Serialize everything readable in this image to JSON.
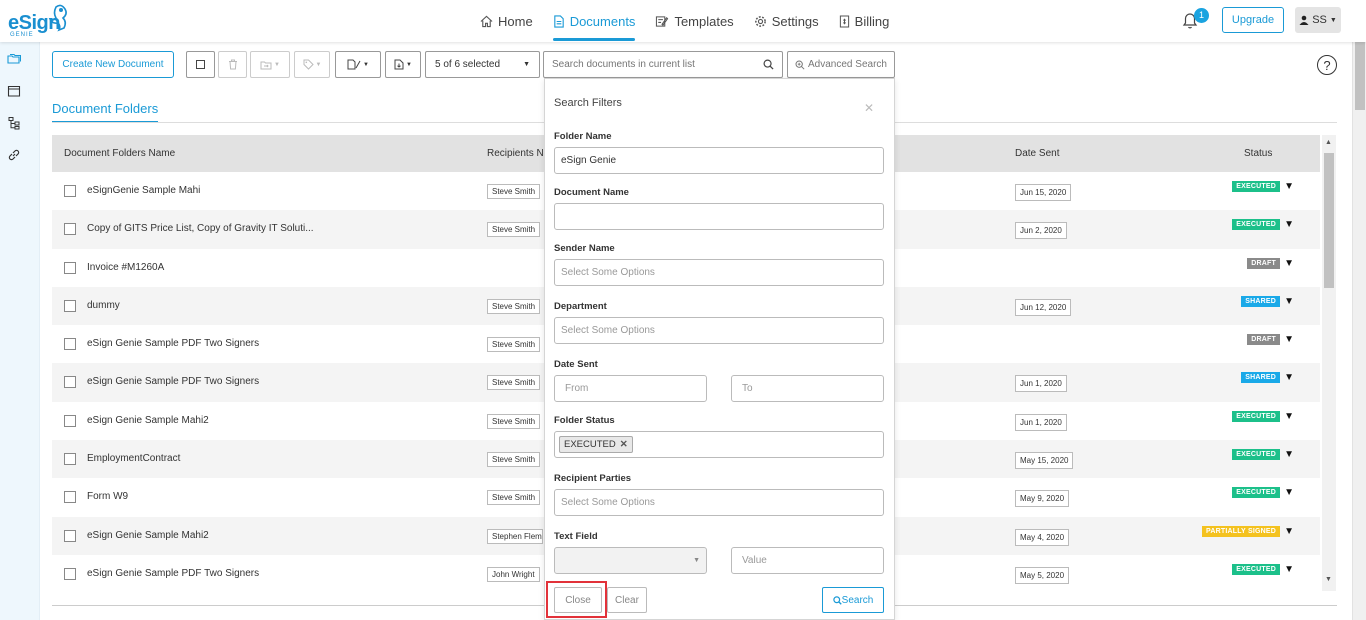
{
  "brand": {
    "logo_text": "eSign",
    "logo_sub": "GENIE"
  },
  "nav": [
    {
      "label": "Home",
      "icon": "home-icon"
    },
    {
      "label": "Documents",
      "icon": "document-icon",
      "active": true
    },
    {
      "label": "Templates",
      "icon": "template-icon"
    },
    {
      "label": "Settings",
      "icon": "gear-icon"
    },
    {
      "label": "Billing",
      "icon": "billing-icon"
    }
  ],
  "header": {
    "notification_count": "1",
    "upgrade_label": "Upgrade",
    "user_initials": "SS"
  },
  "toolbar": {
    "create_label": "Create New Document",
    "selection": "5 of 6 selected",
    "search_placeholder": "Search documents in current list",
    "advanced_label": "Advanced Search"
  },
  "section": {
    "title": "Document Folders"
  },
  "table": {
    "headers": {
      "name": "Document Folders Name",
      "recipients": "Recipients Na",
      "date": "Date Sent",
      "status": "Status"
    },
    "rows": [
      {
        "name": "eSignGenie Sample Mahi",
        "recipient": "Steve Smith",
        "date": "Jun 15, 2020",
        "status": "EXECUTED"
      },
      {
        "name": "Copy of GITS Price List, Copy of Gravity IT Soluti...",
        "recipient": "Steve Smith",
        "date": "Jun 2, 2020",
        "status": "EXECUTED"
      },
      {
        "name": "Invoice #M1260A",
        "recipient": "",
        "date": "",
        "status": "DRAFT"
      },
      {
        "name": "dummy",
        "recipient": "Steve Smith",
        "date": "Jun 12, 2020",
        "status": "SHARED"
      },
      {
        "name": "eSign Genie Sample PDF Two Signers",
        "recipient": "Steve Smith",
        "date": "",
        "status": "DRAFT"
      },
      {
        "name": "eSign Genie Sample PDF Two Signers",
        "recipient": "Steve Smith",
        "date": "Jun 1, 2020",
        "status": "SHARED"
      },
      {
        "name": "eSign Genie Sample Mahi2",
        "recipient": "Steve Smith",
        "date": "Jun 1, 2020",
        "status": "EXECUTED"
      },
      {
        "name": "EmploymentContract",
        "recipient": "Steve Smith",
        "date": "May 15, 2020",
        "status": "EXECUTED"
      },
      {
        "name": "Form W9",
        "recipient": "Steve Smith",
        "date": "May 9, 2020",
        "status": "EXECUTED"
      },
      {
        "name": "eSign Genie Sample Mahi2",
        "recipient": "Stephen Flemi",
        "date": "May 4, 2020",
        "status": "PARTIALLY SIGNED"
      },
      {
        "name": "eSign Genie Sample PDF Two Signers",
        "recipient": "John Wright",
        "date": "May 5, 2020",
        "status": "EXECUTED"
      }
    ]
  },
  "status_colors": {
    "EXECUTED": "#1cc08a",
    "DRAFT": "#8a8a8a",
    "SHARED": "#1aa9e8",
    "PARTIALLY SIGNED": "#f4c21f"
  },
  "filters": {
    "title": "Search Filters",
    "folder_name_label": "Folder Name",
    "folder_name_value": "eSign Genie",
    "document_name_label": "Document Name",
    "document_name_value": "",
    "sender_name_label": "Sender Name",
    "sender_name_placeholder": "Select Some Options",
    "department_label": "Department",
    "department_placeholder": "Select Some Options",
    "date_sent_label": "Date Sent",
    "date_from_placeholder": "From",
    "date_to_placeholder": "To",
    "folder_status_label": "Folder Status",
    "folder_status_tag": "EXECUTED",
    "recipient_parties_label": "Recipient Parties",
    "recipient_parties_placeholder": "Select Some Options",
    "text_field_label": "Text Field",
    "text_field_value_placeholder": "Value",
    "close_label": "Close",
    "clear_label": "Clear",
    "search_label": "Search"
  }
}
